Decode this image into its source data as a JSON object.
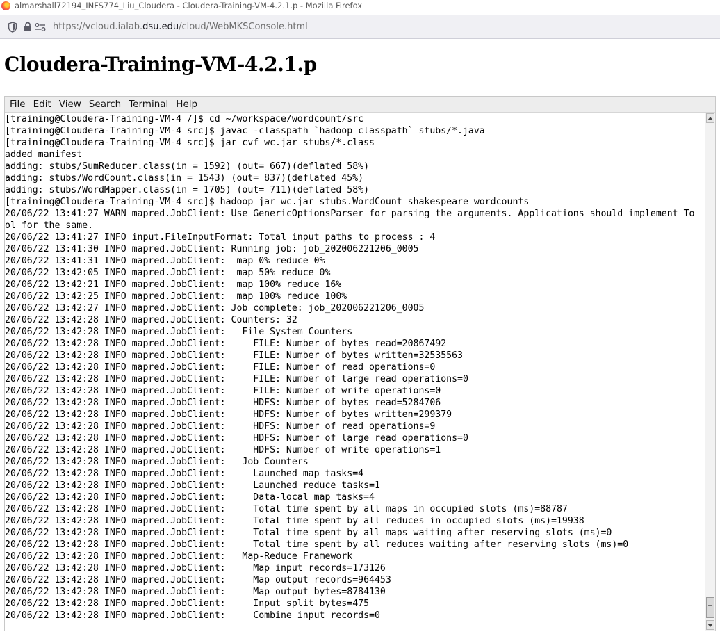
{
  "window": {
    "title": "almarshall72194_INFS774_Liu_Cloudera - Cloudera-Training-VM-4.2.1.p - Mozilla Firefox",
    "logo_icon": "firefox-icon"
  },
  "urlbar": {
    "prefix": "https://vcloud.ialab.",
    "host": "dsu.edu",
    "path": "/cloud/WebMKSConsole.html",
    "icons": [
      "shield-icon",
      "lock-icon",
      "permissions-icon"
    ]
  },
  "page": {
    "title": "Cloudera-Training-VM-4.2.1.p"
  },
  "terminal": {
    "menu": [
      {
        "acc": "F",
        "rest": "ile"
      },
      {
        "acc": "E",
        "rest": "dit"
      },
      {
        "acc": "V",
        "rest": "iew"
      },
      {
        "acc": "S",
        "rest": "earch"
      },
      {
        "acc": "T",
        "rest": "erminal"
      },
      {
        "acc": "H",
        "rest": "elp"
      }
    ],
    "lines": [
      "[training@Cloudera-Training-VM-4 /]$ cd ~/workspace/wordcount/src",
      "[training@Cloudera-Training-VM-4 src]$ javac -classpath `hadoop classpath` stubs/*.java",
      "[training@Cloudera-Training-VM-4 src]$ jar cvf wc.jar stubs/*.class",
      "added manifest",
      "adding: stubs/SumReducer.class(in = 1592) (out= 667)(deflated 58%)",
      "adding: stubs/WordCount.class(in = 1543) (out= 837)(deflated 45%)",
      "adding: stubs/WordMapper.class(in = 1705) (out= 711)(deflated 58%)",
      "[training@Cloudera-Training-VM-4 src]$ hadoop jar wc.jar stubs.WordCount shakespeare wordcounts",
      "20/06/22 13:41:27 WARN mapred.JobClient: Use GenericOptionsParser for parsing the arguments. Applications should implement To",
      "ol for the same.",
      "20/06/22 13:41:27 INFO input.FileInputFormat: Total input paths to process : 4",
      "20/06/22 13:41:30 INFO mapred.JobClient: Running job: job_202006221206_0005",
      "20/06/22 13:41:31 INFO mapred.JobClient:  map 0% reduce 0%",
      "20/06/22 13:42:05 INFO mapred.JobClient:  map 50% reduce 0%",
      "20/06/22 13:42:21 INFO mapred.JobClient:  map 100% reduce 16%",
      "20/06/22 13:42:25 INFO mapred.JobClient:  map 100% reduce 100%",
      "20/06/22 13:42:27 INFO mapred.JobClient: Job complete: job_202006221206_0005",
      "20/06/22 13:42:28 INFO mapred.JobClient: Counters: 32",
      "20/06/22 13:42:28 INFO mapred.JobClient:   File System Counters",
      "20/06/22 13:42:28 INFO mapred.JobClient:     FILE: Number of bytes read=20867492",
      "20/06/22 13:42:28 INFO mapred.JobClient:     FILE: Number of bytes written=32535563",
      "20/06/22 13:42:28 INFO mapred.JobClient:     FILE: Number of read operations=0",
      "20/06/22 13:42:28 INFO mapred.JobClient:     FILE: Number of large read operations=0",
      "20/06/22 13:42:28 INFO mapred.JobClient:     FILE: Number of write operations=0",
      "20/06/22 13:42:28 INFO mapred.JobClient:     HDFS: Number of bytes read=5284706",
      "20/06/22 13:42:28 INFO mapred.JobClient:     HDFS: Number of bytes written=299379",
      "20/06/22 13:42:28 INFO mapred.JobClient:     HDFS: Number of read operations=9",
      "20/06/22 13:42:28 INFO mapred.JobClient:     HDFS: Number of large read operations=0",
      "20/06/22 13:42:28 INFO mapred.JobClient:     HDFS: Number of write operations=1",
      "20/06/22 13:42:28 INFO mapred.JobClient:   Job Counters",
      "20/06/22 13:42:28 INFO mapred.JobClient:     Launched map tasks=4",
      "20/06/22 13:42:28 INFO mapred.JobClient:     Launched reduce tasks=1",
      "20/06/22 13:42:28 INFO mapred.JobClient:     Data-local map tasks=4",
      "20/06/22 13:42:28 INFO mapred.JobClient:     Total time spent by all maps in occupied slots (ms)=88787",
      "20/06/22 13:42:28 INFO mapred.JobClient:     Total time spent by all reduces in occupied slots (ms)=19938",
      "20/06/22 13:42:28 INFO mapred.JobClient:     Total time spent by all maps waiting after reserving slots (ms)=0",
      "20/06/22 13:42:28 INFO mapred.JobClient:     Total time spent by all reduces waiting after reserving slots (ms)=0",
      "20/06/22 13:42:28 INFO mapred.JobClient:   Map-Reduce Framework",
      "20/06/22 13:42:28 INFO mapred.JobClient:     Map input records=173126",
      "20/06/22 13:42:28 INFO mapred.JobClient:     Map output records=964453",
      "20/06/22 13:42:28 INFO mapred.JobClient:     Map output bytes=8784130",
      "20/06/22 13:42:28 INFO mapred.JobClient:     Input split bytes=475",
      "20/06/22 13:42:28 INFO mapred.JobClient:     Combine input records=0"
    ]
  }
}
